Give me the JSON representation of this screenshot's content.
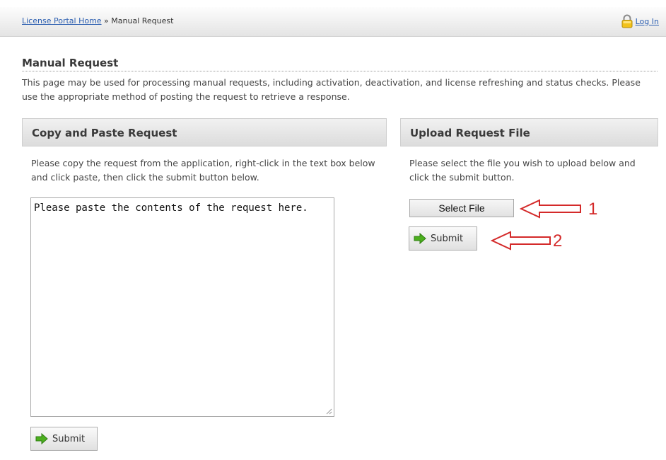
{
  "breadcrumb": {
    "home_link": "License Portal Home",
    "separator": " » ",
    "current": "Manual Request"
  },
  "auth": {
    "login_label": "Log In",
    "icon": "lock-icon"
  },
  "page": {
    "title": "Manual Request",
    "intro": "This page may be used for processing manual requests, including activation, deactivation, and license refreshing and status checks. Please use the appropriate method of posting the request to retrieve a response."
  },
  "copy_paste": {
    "heading": "Copy and Paste Request",
    "instructions": "Please copy the request from the application, right-click in the text box below and click paste, then click the submit button below.",
    "textarea_value": "Please paste the contents of the request here.",
    "submit_label": "Submit"
  },
  "upload": {
    "heading": "Upload Request File",
    "instructions": "Please select the file you wish to upload below and click the submit button.",
    "select_label": "Select File",
    "submit_label": "Submit"
  },
  "annotations": {
    "first": "1",
    "second": "2",
    "color": "#d42a2a"
  },
  "colors": {
    "link": "#2a5db0",
    "submit_arrow": "#4caf1e"
  }
}
